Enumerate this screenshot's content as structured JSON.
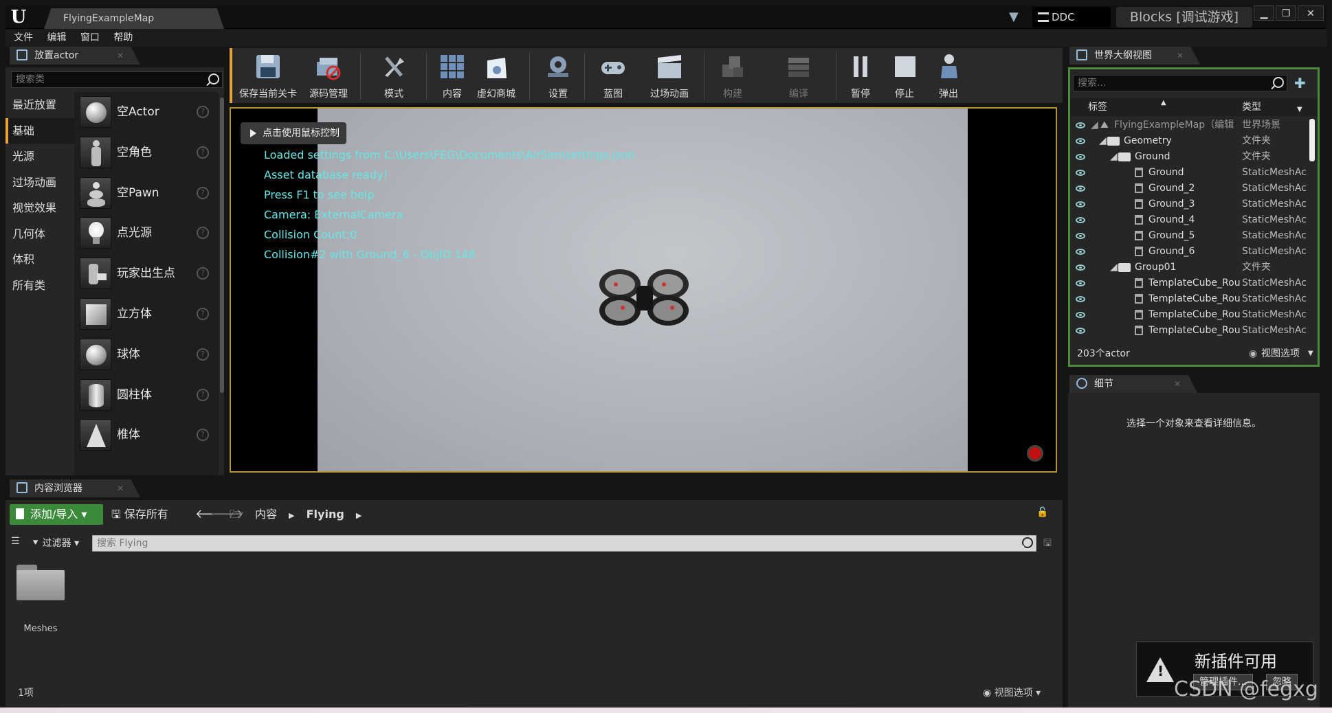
{
  "title_bar": {
    "map_tab": "FlyingExampleMap",
    "ddc": "DDC",
    "project": "Blocks [调试游戏]"
  },
  "menu": [
    "文件",
    "编辑",
    "窗口",
    "帮助"
  ],
  "place_actor": {
    "tab": "放置actor",
    "search_placeholder": "搜索类",
    "categories": [
      "最近放置",
      "基础",
      "光源",
      "过场动画",
      "视觉效果",
      "几何体",
      "体积",
      "所有类"
    ],
    "active_category": "基础",
    "items": [
      "空Actor",
      "空角色",
      "空Pawn",
      "点光源",
      "玩家出生点",
      "立方体",
      "球体",
      "圆柱体",
      "椎体"
    ]
  },
  "toolbar": {
    "buttons": [
      "保存当前关卡",
      "源码管理",
      "模式",
      "内容",
      "虚幻商城",
      "设置",
      "蓝图",
      "过场动画",
      "构建",
      "编译",
      "暂停",
      "停止",
      "弹出"
    ]
  },
  "viewport": {
    "hint": "点击使用鼠标控制",
    "log": [
      "Loaded settings from C:\\Users\\FEG\\Documents\\AirSim\\settings.json",
      "Asset database ready!",
      "Press F1 to see help",
      "Camera: ExternalCamera",
      "Collision Count:0",
      "Collision#2 with Ground_6 - ObjID 148"
    ]
  },
  "outliner": {
    "tab": "世界大纲视图",
    "search_placeholder": "搜索...",
    "col_label": "标签",
    "col_type": "类型",
    "rows": [
      {
        "name": "FlyingExampleMap（编辑",
        "type": "世界场景"
      },
      {
        "name": "Geometry",
        "type": "文件夹"
      },
      {
        "name": "Ground",
        "type": "文件夹"
      },
      {
        "name": "Ground",
        "type": "StaticMeshAc"
      },
      {
        "name": "Ground_2",
        "type": "StaticMeshAc"
      },
      {
        "name": "Ground_3",
        "type": "StaticMeshAc"
      },
      {
        "name": "Ground_4",
        "type": "StaticMeshAc"
      },
      {
        "name": "Ground_5",
        "type": "StaticMeshAc"
      },
      {
        "name": "Ground_6",
        "type": "StaticMeshAc"
      },
      {
        "name": "Group01",
        "type": "文件夹"
      },
      {
        "name": "TemplateCube_Rou",
        "type": "StaticMeshAc"
      },
      {
        "name": "TemplateCube_Rou",
        "type": "StaticMeshAc"
      },
      {
        "name": "TemplateCube_Rou",
        "type": "StaticMeshAc"
      },
      {
        "name": "TemplateCube_Rou",
        "type": "StaticMeshAc"
      }
    ],
    "count": "203个actor",
    "view_options": "视图选项"
  },
  "details": {
    "tab": "细节",
    "empty_text": "选择一个对象来查看详细信息。"
  },
  "content_browser": {
    "tab": "内容浏览器",
    "add_import": "添加/导入",
    "save_all": "保存所有",
    "path": [
      "内容",
      "Flying"
    ],
    "filters": "过滤器",
    "search_placeholder": "搜索 Flying",
    "folder": "Meshes",
    "item_count": "1项",
    "view_options": "视图选项"
  },
  "notification": {
    "title": "新插件可用",
    "manage": "管理插件...",
    "ignore": "忽略"
  },
  "watermark": "CSDN @fegxg",
  "colors": {
    "accent": "#e8a33a",
    "add_button": "#3a8a3a",
    "log_text": "#66e6e6",
    "outliner_border": "#4a8a3a"
  }
}
